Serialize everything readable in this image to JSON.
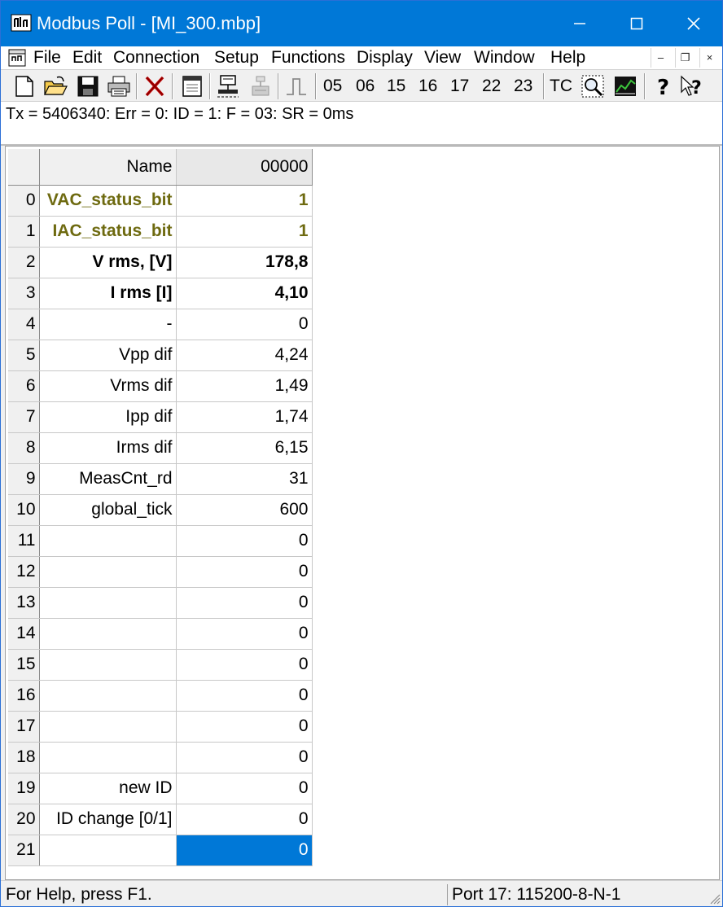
{
  "window": {
    "title": "Modbus Poll - [MI_300.mbp]",
    "accent_color": "#0078d7",
    "controls": {
      "minimize_icon": "minimize-icon",
      "maximize_icon": "maximize-icon",
      "close_icon": "close-icon"
    }
  },
  "menu": {
    "items": [
      "File",
      "Edit",
      "Connection",
      "Setup",
      "Functions",
      "Display",
      "View",
      "Window",
      "Help"
    ],
    "mdi": {
      "minimize": "‒",
      "restore": "❐",
      "close": "×"
    }
  },
  "toolbar": {
    "icons": [
      "new-document-icon",
      "open-folder-icon",
      "save-icon",
      "print-icon",
      "delete-icon",
      "window-icon",
      "connect-icon",
      "disconnect-icon",
      "pulse-icon",
      "traffic-monitor-icon",
      "chart-icon",
      "help-icon",
      "context-help-icon"
    ],
    "codes": [
      "05",
      "06",
      "15",
      "16",
      "17",
      "22",
      "23"
    ],
    "tc_label": "TC"
  },
  "status_line": "Tx = 5406340: Err = 0: ID = 1: F = 03: SR = 0ms",
  "grid": {
    "header_name": "Name",
    "header_value": "00000",
    "rows": [
      {
        "index": "0",
        "name": "VAC_status_bit",
        "value": "1",
        "style": "olive"
      },
      {
        "index": "1",
        "name": "IAC_status_bit",
        "value": "1",
        "style": "olive"
      },
      {
        "index": "2",
        "name": "V rms, [V]",
        "value": "178,8",
        "style": "bold"
      },
      {
        "index": "3",
        "name": "I rms [I]",
        "value": "4,10",
        "style": "bold"
      },
      {
        "index": "4",
        "name": "-",
        "value": "0",
        "style": ""
      },
      {
        "index": "5",
        "name": "Vpp dif",
        "value": "4,24",
        "style": ""
      },
      {
        "index": "6",
        "name": "Vrms dif",
        "value": "1,49",
        "style": ""
      },
      {
        "index": "7",
        "name": "Ipp dif",
        "value": "1,74",
        "style": ""
      },
      {
        "index": "8",
        "name": "Irms dif",
        "value": "6,15",
        "style": ""
      },
      {
        "index": "9",
        "name": "MeasCnt_rd",
        "value": "31",
        "style": ""
      },
      {
        "index": "10",
        "name": "global_tick",
        "value": "600",
        "style": ""
      },
      {
        "index": "11",
        "name": "",
        "value": "0",
        "style": ""
      },
      {
        "index": "12",
        "name": "",
        "value": "0",
        "style": ""
      },
      {
        "index": "13",
        "name": "",
        "value": "0",
        "style": ""
      },
      {
        "index": "14",
        "name": "",
        "value": "0",
        "style": ""
      },
      {
        "index": "15",
        "name": "",
        "value": "0",
        "style": ""
      },
      {
        "index": "16",
        "name": "",
        "value": "0",
        "style": ""
      },
      {
        "index": "17",
        "name": "",
        "value": "0",
        "style": ""
      },
      {
        "index": "18",
        "name": "",
        "value": "0",
        "style": ""
      },
      {
        "index": "19",
        "name": "new ID",
        "value": "0",
        "style": ""
      },
      {
        "index": "20",
        "name": "ID change [0/1]",
        "value": "0",
        "style": ""
      },
      {
        "index": "21",
        "name": "",
        "value": "0",
        "style": "selected"
      }
    ],
    "olive_color": "#6e6a10",
    "selection_color": "#0078d7"
  },
  "statusbar": {
    "help_text": "For Help, press F1.",
    "port_text": "Port 17: 115200-8-N-1"
  }
}
